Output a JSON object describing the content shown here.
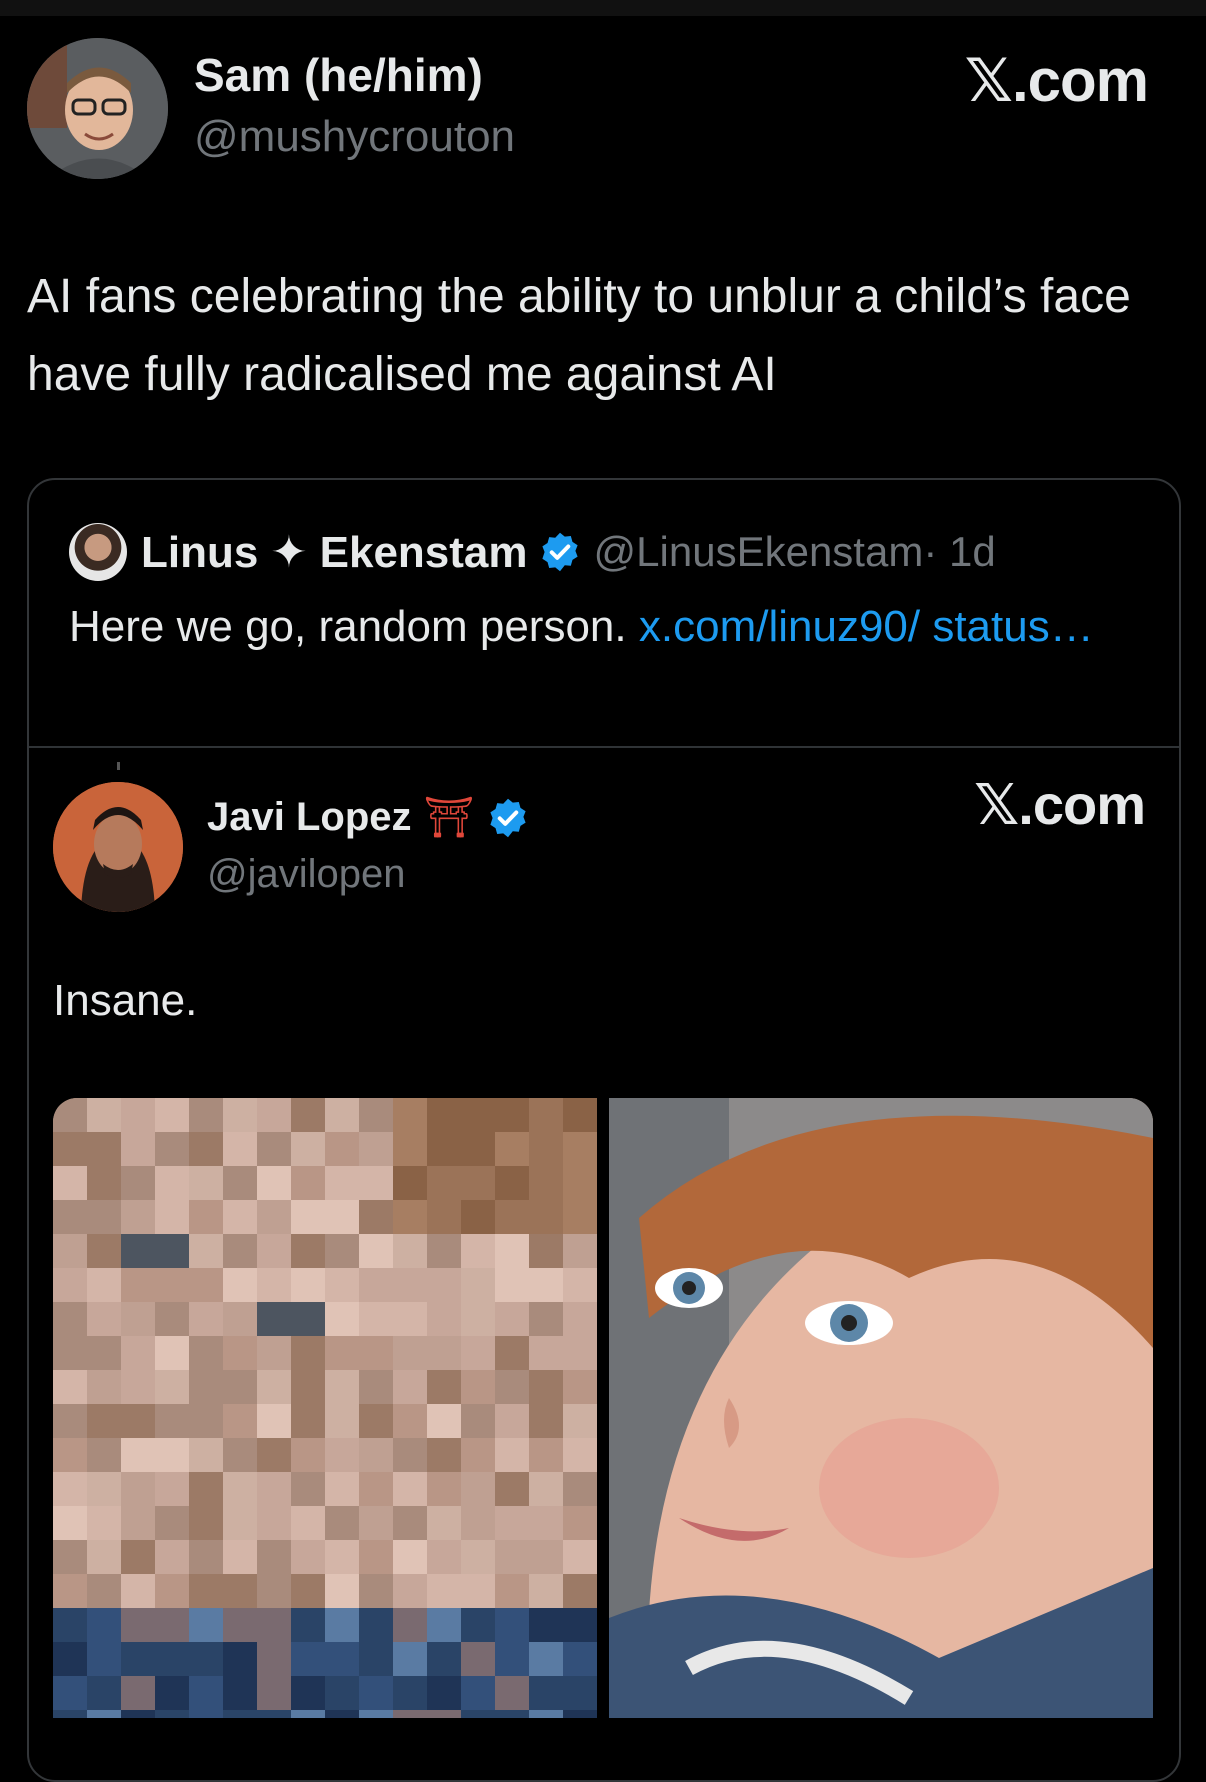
{
  "post": {
    "author_name": "Sam (he/him)",
    "author_handle": "@mushycrouton",
    "brand": "𝕏.com",
    "text": "AI fans celebrating the ability to unblur a child’s face have fully radicalised me against AI"
  },
  "quote": {
    "author_name": "Linus ✦ Ekenstam",
    "author_handle": "@LinusEkenstam",
    "time": "· 1d",
    "text": "Here we go, random person.",
    "link": "x.com/linuz90/ status…"
  },
  "embedded": {
    "author_name": "Javi Lopez",
    "author_emoji": "⛩",
    "author_handle": "@javilopen",
    "brand": "𝕏.com",
    "text": "Insane."
  },
  "icons": {
    "verified_badge": "verified-badge-icon",
    "verified_color": "#1d9bf0"
  }
}
